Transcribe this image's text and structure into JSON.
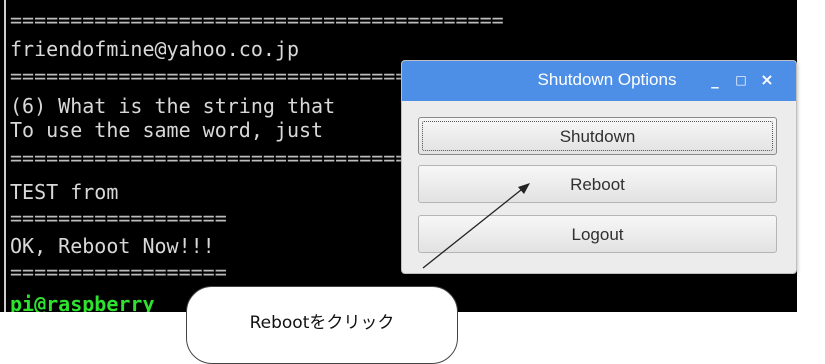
{
  "terminal": {
    "lines": [
      "=========================================",
      "friendofmine@yahoo.co.jp",
      "=========================================",
      "(6) What is the string that",
      "To use the same word, just",
      "=========================================",
      "TEST from",
      "==================",
      "OK, Reboot Now!!!",
      "=================="
    ],
    "prompt": "pi@raspberry"
  },
  "dialog": {
    "title": "Shutdown Options",
    "buttons": {
      "shutdown": "Shutdown",
      "reboot": "Reboot",
      "logout": "Logout"
    },
    "controls": {
      "minimize": "_",
      "maximize": "□",
      "close": "×"
    }
  },
  "annotation": {
    "text": "Rebootをクリック"
  }
}
